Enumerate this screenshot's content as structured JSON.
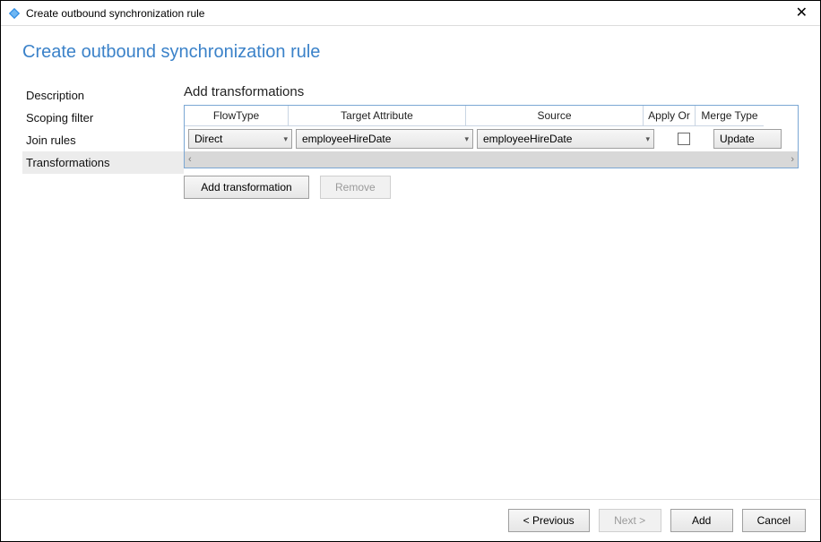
{
  "window": {
    "title": "Create outbound synchronization rule"
  },
  "page": {
    "heading": "Create outbound synchronization rule"
  },
  "sidebar": {
    "items": [
      {
        "label": "Description",
        "selected": false
      },
      {
        "label": "Scoping filter",
        "selected": false
      },
      {
        "label": "Join rules",
        "selected": false
      },
      {
        "label": "Transformations",
        "selected": true
      }
    ]
  },
  "transformations": {
    "section_title": "Add transformations",
    "columns": {
      "flowtype": "FlowType",
      "target": "Target Attribute",
      "source": "Source",
      "apply_or": "Apply Or",
      "merge": "Merge Type"
    },
    "rows": [
      {
        "flowtype": "Direct",
        "target": "employeeHireDate",
        "source": "employeeHireDate",
        "apply_once": false,
        "merge": "Update"
      }
    ],
    "buttons": {
      "add": "Add transformation",
      "remove": "Remove"
    }
  },
  "footer": {
    "previous": "< Previous",
    "next": "Next >",
    "add": "Add",
    "cancel": "Cancel"
  }
}
